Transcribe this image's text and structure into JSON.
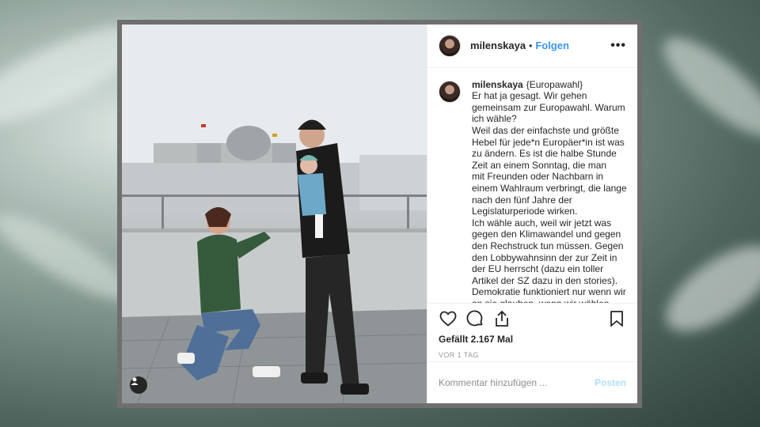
{
  "post": {
    "username": "milenskaya",
    "separator": "•",
    "follow_label": "Folgen",
    "more_icon": "•••",
    "caption_title": "{Europawahl}",
    "caption_text": "Er hat ja gesagt. Wir gehen gemeinsam zur Europawahl. Warum ich wähle?\nWeil das der einfachste und größte Hebel für jede*n Europäer*in ist was zu ändern. Es ist die halbe Stunde Zeit an einem Sonntag, die man\nmit Freunden oder Nachbarn in einem Wahlraum verbringt, die lange nach den fünf Jahre der Legislaturperiode wirken.\nIch wähle auch, weil wir jetzt was gegen den Klimawandel und gegen den Rechstruck tun müssen. Gegen den Lobbywahnsinn der zur Zeit in der EU herrscht (dazu ein toller Artikel der SZ dazu in den stories). Demokratie funktioniert nur wenn wir an sie glauben, wenn wir wählen. Ganz besonders wir jungen Menschen, die",
    "likes": "Gefällt 2.167 Mal",
    "time": "VOR 1 TAG",
    "comment_placeholder": "Kommentar hinzufügen ...",
    "post_label": "Posten"
  },
  "icons": {
    "like": "heart-icon",
    "comment": "comment-icon",
    "share": "share-icon",
    "save": "bookmark-icon",
    "user_tag": "user-icon"
  },
  "colors": {
    "follow": "#3897f0",
    "post_disabled": "#b2dffc",
    "text": "#262626"
  }
}
